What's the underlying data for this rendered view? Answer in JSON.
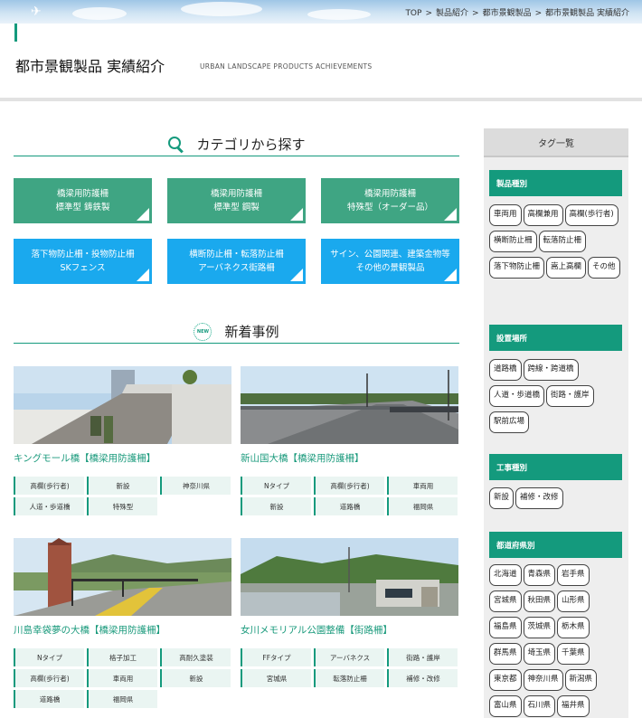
{
  "breadcrumb": {
    "items": [
      "TOP",
      "製品紹介",
      "都市景観製品",
      "都市景観製品 実績紹介"
    ],
    "separator": ">"
  },
  "page": {
    "title": "都市景観製品 実績紹介",
    "subtitle": "URBAN LANDSCAPE PRODUCTS ACHIEVEMENTS"
  },
  "category_section": {
    "heading": "カテゴリから探す"
  },
  "categories": [
    {
      "line1": "橋梁用防護柵",
      "line2": "標準型 鋳鉄製"
    },
    {
      "line1": "橋梁用防護柵",
      "line2": "標準型 鋼製"
    },
    {
      "line1": "橋梁用防護柵",
      "line2": "特殊型（オーダー品）"
    },
    {
      "line1": "落下物防止柵・投物防止柵",
      "line2": "SKフェンス"
    },
    {
      "line1": "横断防止柵・転落防止柵",
      "line2": "アーバネクス街路柵"
    },
    {
      "line1": "サイン、公園関連、建築金物等",
      "line2": "その他の景観製品"
    }
  ],
  "news_section": {
    "heading": "新着事例",
    "badge": "NEW"
  },
  "cases": [
    {
      "title": "キングモール橋【橋梁用防護柵】",
      "tags": [
        "高欄(歩行者)",
        "新設",
        "神奈川県",
        "人道・歩道橋",
        "特殊型"
      ]
    },
    {
      "title": "新山国大橋【橋梁用防護柵】",
      "tags": [
        "Nタイプ",
        "高欄(歩行者)",
        "車両用",
        "新設",
        "道路橋",
        "福岡県"
      ]
    },
    {
      "title": "川島幸袋夢の大橋【橋梁用防護柵】",
      "tags": [
        "Nタイプ",
        "格子加工",
        "高耐久塗装",
        "高欄(歩行者)",
        "車両用",
        "新設",
        "道路橋",
        "福岡県"
      ]
    },
    {
      "title": "女川メモリアル公園整備【街路柵】",
      "tags": [
        "FFタイプ",
        "アーバネクス",
        "街路・護岸",
        "宮城県",
        "転落防止柵",
        "補修・改修"
      ]
    }
  ],
  "sidebar": {
    "heading": "タグ一覧",
    "groups": [
      {
        "name": "製品種別",
        "tags": [
          "車両用",
          "高欄兼用",
          "高欄(歩行者)",
          "横断防止柵",
          "転落防止柵",
          "落下物防止柵",
          "嵩上高欄",
          "その他"
        ]
      },
      {
        "name": "設置場所",
        "tags": [
          "道路橋",
          "跨線・跨道橋",
          "人道・歩道橋",
          "街路・護岸",
          "駅前広場"
        ]
      },
      {
        "name": "工事種別",
        "tags": [
          "新設",
          "補修・改修"
        ]
      },
      {
        "name": "都道府県別",
        "tags": [
          "北海道",
          "青森県",
          "岩手県",
          "宮城県",
          "秋田県",
          "山形県",
          "福島県",
          "茨城県",
          "栃木県",
          "群馬県",
          "埼玉県",
          "千葉県",
          "東京都",
          "神奈川県",
          "新潟県",
          "富山県",
          "石川県",
          "福井県"
        ]
      }
    ]
  },
  "colors": {
    "accent": "#149a7d",
    "category_green": "#3fa583",
    "category_blue": "#1aa9ee",
    "tag_bg": "#eaf5f2"
  }
}
